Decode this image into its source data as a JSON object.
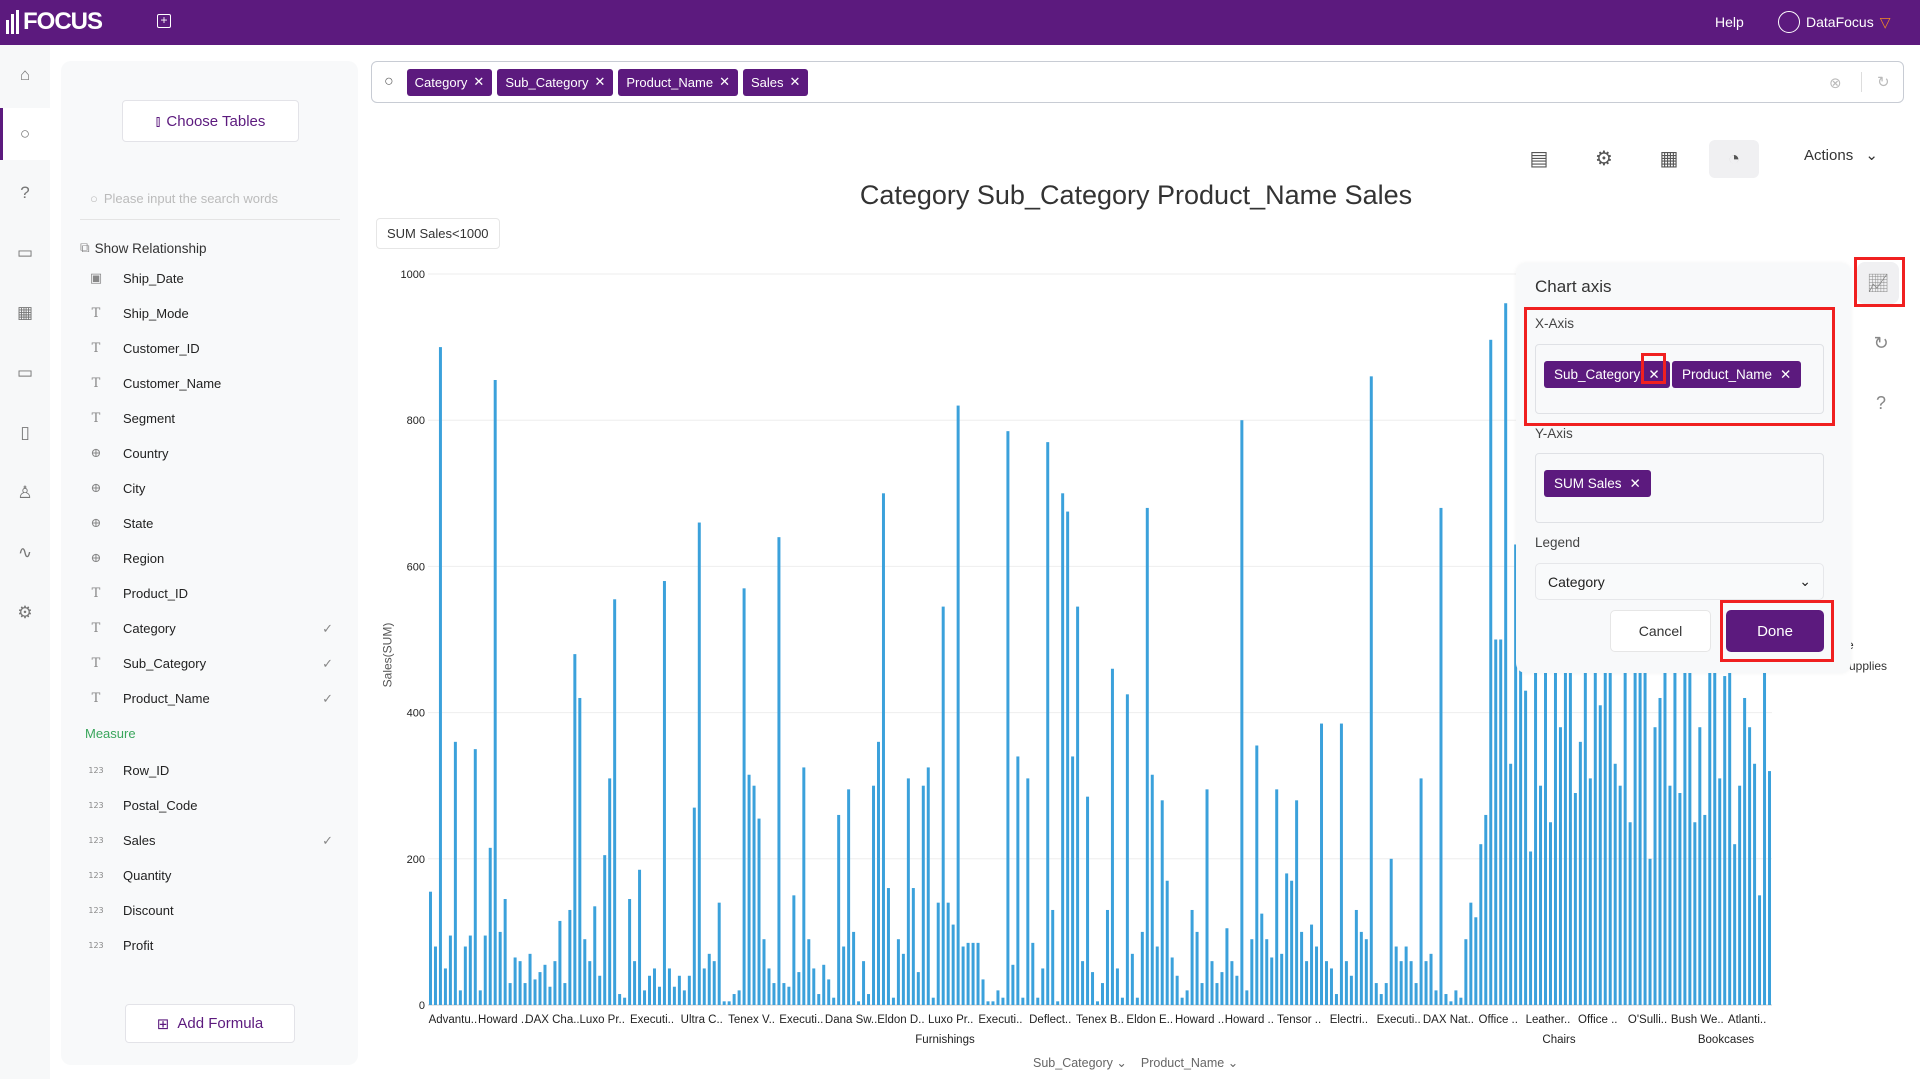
{
  "app": {
    "name": "FOCUS",
    "help": "Help",
    "user": "DataFocus"
  },
  "colors": {
    "brand": "#5c1a7e",
    "bar": "#3ba1db",
    "highlight": "#f02020"
  },
  "search": {
    "tokens": [
      "Category",
      "Sub_Category",
      "Product_Name",
      "Sales"
    ]
  },
  "sidebar": {
    "choose_tables": "Choose Tables",
    "search_placeholder": "Please input the search words",
    "show_relationship": "Show Relationship",
    "attributes": [
      {
        "name": "Ship_Date",
        "icon": "calendar-icon",
        "checked": false
      },
      {
        "name": "Ship_Mode",
        "icon": "text-icon",
        "checked": false
      },
      {
        "name": "Customer_ID",
        "icon": "text-icon",
        "checked": false
      },
      {
        "name": "Customer_Name",
        "icon": "text-icon",
        "checked": false
      },
      {
        "name": "Segment",
        "icon": "text-icon",
        "checked": false
      },
      {
        "name": "Country",
        "icon": "globe-icon",
        "checked": false
      },
      {
        "name": "City",
        "icon": "globe-icon",
        "checked": false
      },
      {
        "name": "State",
        "icon": "globe-icon",
        "checked": false
      },
      {
        "name": "Region",
        "icon": "globe-icon",
        "checked": false
      },
      {
        "name": "Product_ID",
        "icon": "text-icon",
        "checked": false
      },
      {
        "name": "Category",
        "icon": "text-icon",
        "checked": true
      },
      {
        "name": "Sub_Category",
        "icon": "text-icon",
        "checked": true
      },
      {
        "name": "Product_Name",
        "icon": "text-icon",
        "checked": true
      }
    ],
    "measure_heading": "Measure",
    "measures": [
      {
        "name": "Row_ID",
        "checked": false
      },
      {
        "name": "Postal_Code",
        "checked": false
      },
      {
        "name": "Sales",
        "checked": true
      },
      {
        "name": "Quantity",
        "checked": false
      },
      {
        "name": "Discount",
        "checked": false
      },
      {
        "name": "Profit",
        "checked": false
      }
    ],
    "measure_icon_text": "123",
    "add_formula": "Add Formula"
  },
  "toolbar": {
    "actions": "Actions"
  },
  "main": {
    "title": "Category Sub_Category Product_Name Sales",
    "filter": "SUM Sales<1000"
  },
  "chart_data": {
    "type": "bar",
    "ylabel": "Sales(SUM)",
    "ylim": [
      0,
      1000
    ],
    "yticks": [
      0,
      200,
      400,
      600,
      800,
      1000
    ],
    "grid": true,
    "x_tick_labels": [
      "Advantu..",
      "Howard ..",
      "DAX Cha..",
      "Luxo Pr..",
      "Executi..",
      "Ultra C..",
      "Tenex V..",
      "Executi..",
      "Dana Sw..",
      "Eldon D..",
      "Luxo Pr..",
      "Executi..",
      "Deflect..",
      "Tenex B..",
      "Eldon E..",
      "Howard ..",
      "Howard ..",
      "Tensor ..",
      "Electri..",
      "Executi..",
      "DAX Nat..",
      "Office ..",
      "Leather..",
      "Office ..",
      "O'Sulli..",
      "Bush We..",
      "Atlanti.."
    ],
    "group_labels": [
      "Furnishings",
      "Chairs",
      "Bookcases"
    ],
    "legend_visible_fragments": [
      "re",
      "Supplies"
    ],
    "x_axis_fields": [
      "Sub_Category",
      "Product_Name"
    ],
    "values": [
      155,
      80,
      900,
      50,
      95,
      360,
      20,
      80,
      95,
      350,
      20,
      95,
      215,
      855,
      100,
      145,
      30,
      65,
      60,
      30,
      70,
      35,
      45,
      55,
      25,
      60,
      115,
      30,
      130,
      480,
      420,
      90,
      60,
      135,
      40,
      205,
      310,
      555,
      15,
      10,
      145,
      60,
      185,
      20,
      40,
      50,
      25,
      580,
      50,
      25,
      40,
      20,
      40,
      270,
      660,
      50,
      70,
      60,
      140,
      5,
      5,
      15,
      20,
      570,
      315,
      300,
      255,
      90,
      50,
      30,
      640,
      30,
      25,
      150,
      45,
      325,
      90,
      50,
      15,
      55,
      35,
      10,
      260,
      80,
      295,
      100,
      5,
      60,
      15,
      300,
      360,
      700,
      160,
      10,
      90,
      70,
      310,
      160,
      45,
      300,
      325,
      10,
      140,
      545,
      140,
      110,
      820,
      80,
      85,
      85,
      85,
      35,
      5,
      5,
      20,
      10,
      785,
      55,
      340,
      10,
      310,
      85,
      10,
      50,
      770,
      130,
      5,
      700,
      675,
      340,
      545,
      60,
      285,
      45,
      5,
      30,
      130,
      460,
      50,
      10,
      425,
      70,
      10,
      100,
      680,
      315,
      80,
      280,
      170,
      65,
      40,
      10,
      20,
      130,
      100,
      30,
      295,
      60,
      30,
      45,
      105,
      60,
      40,
      800,
      20,
      90,
      355,
      125,
      90,
      65,
      295,
      70,
      180,
      170,
      280,
      100,
      60,
      110,
      80,
      385,
      60,
      50,
      15,
      385,
      60,
      40,
      130,
      100,
      90,
      860,
      30,
      15,
      30,
      200,
      80,
      60,
      80,
      60,
      30,
      310,
      60,
      70,
      20,
      680,
      15,
      5,
      20,
      10,
      90,
      140,
      120,
      220,
      260,
      910,
      500,
      500,
      960,
      330,
      630,
      810,
      430,
      210,
      520,
      300,
      480,
      250,
      520,
      380,
      500,
      470,
      290,
      360,
      520,
      310,
      500,
      410,
      500,
      520,
      330,
      300,
      600,
      250,
      500,
      470,
      520,
      200,
      380,
      420,
      560,
      300,
      500,
      290,
      520,
      480,
      250,
      380,
      260,
      540,
      470,
      310,
      450,
      520,
      220,
      300,
      420,
      380,
      330,
      150,
      500,
      320
    ]
  },
  "chart_axis_panel": {
    "title": "Chart axis",
    "x_axis_label": "X-Axis",
    "x_axis_chips": [
      "Sub_Category",
      "Product_Name"
    ],
    "y_axis_label": "Y-Axis",
    "y_axis_chips": [
      "SUM Sales"
    ],
    "legend_label": "Legend",
    "legend_value": "Category",
    "cancel": "Cancel",
    "done": "Done"
  }
}
